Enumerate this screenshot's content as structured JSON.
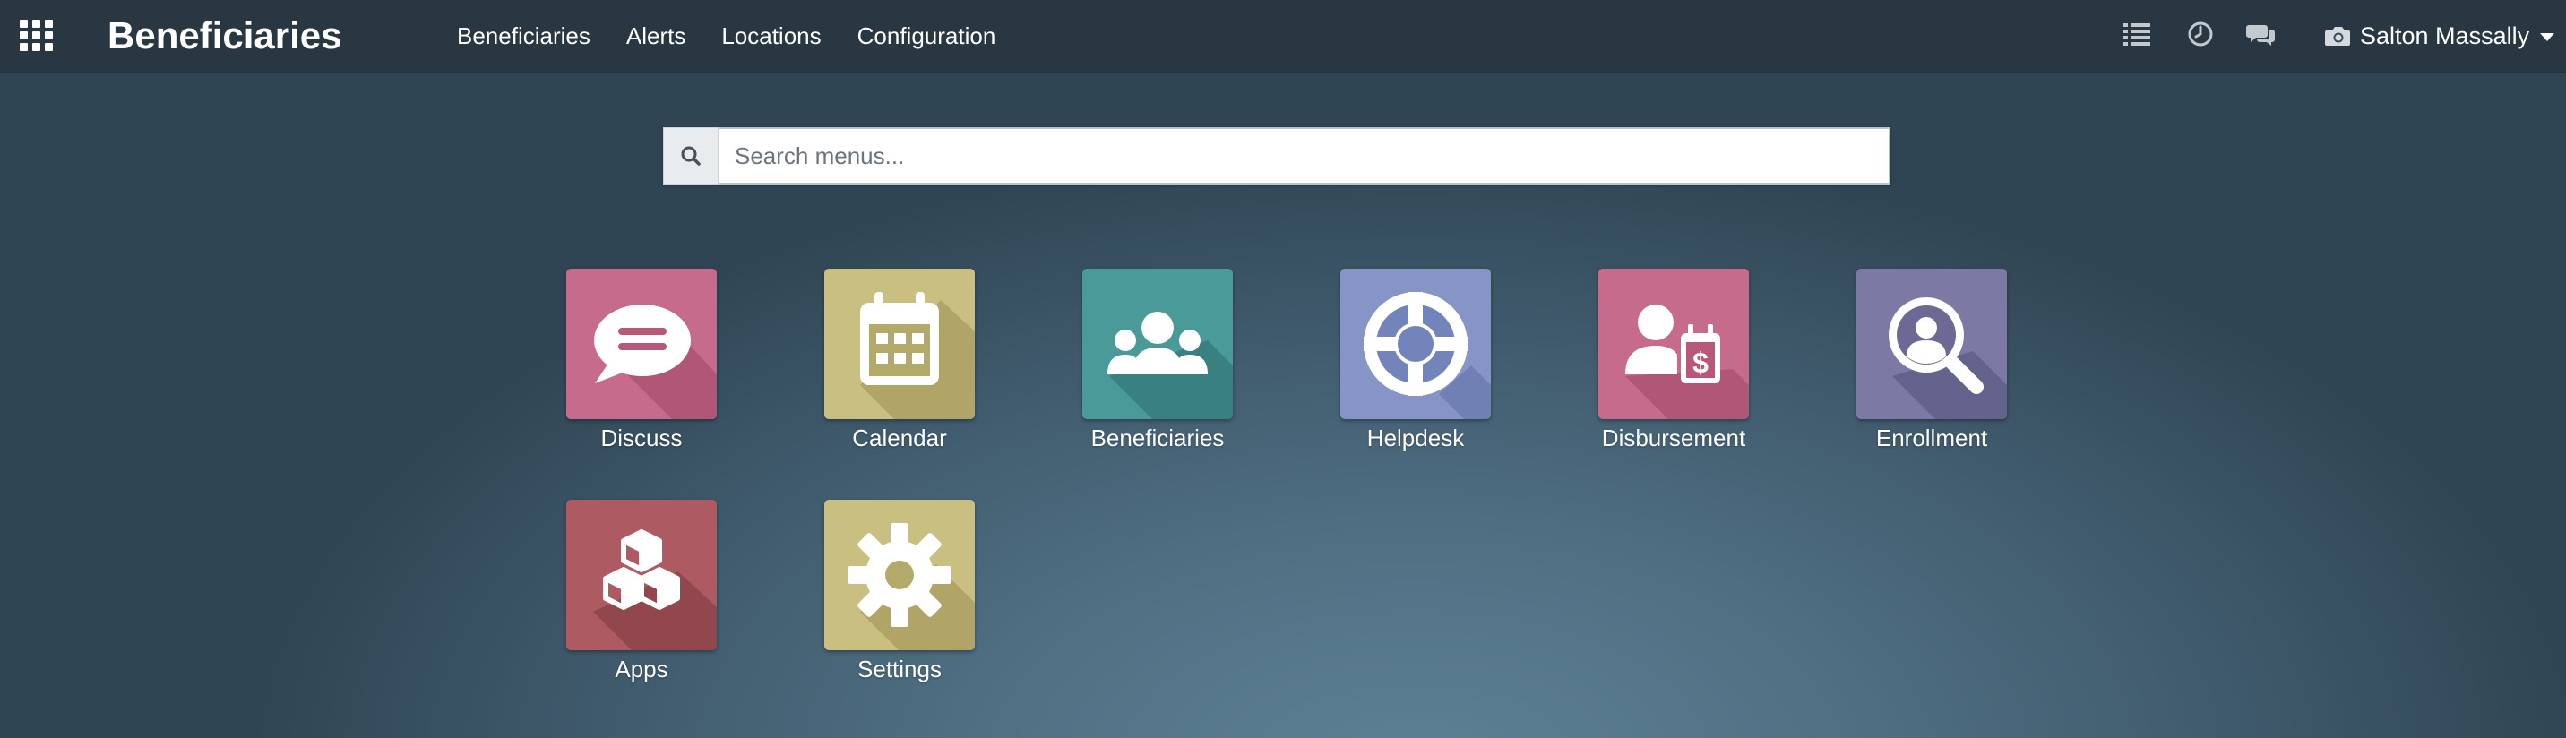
{
  "navbar": {
    "apps_icon": "grid-icon",
    "brand": "Beneficiaries",
    "menu": [
      {
        "label": "Beneficiaries"
      },
      {
        "label": "Alerts"
      },
      {
        "label": "Locations"
      },
      {
        "label": "Configuration"
      }
    ],
    "systray": {
      "icons": [
        "activity-list-icon",
        "clock-icon",
        "chat-icon"
      ]
    },
    "user": {
      "icon": "camera-icon",
      "name": "Salton Massally"
    }
  },
  "search": {
    "placeholder": "Search menus...",
    "value": "",
    "icon": "search-icon"
  },
  "apps": [
    {
      "label": "Discuss",
      "icon": "discuss-icon",
      "color": "#b8577a",
      "color_light": "#c96d8e"
    },
    {
      "label": "Calendar",
      "icon": "calendar-icon",
      "color": "#b3aa6a",
      "color_light": "#c9bf80"
    },
    {
      "label": "Beneficiaries",
      "icon": "beneficiaries-icon",
      "color": "#3f8a8b",
      "color_light": "#4a9a9a"
    },
    {
      "label": "Helpdesk",
      "icon": "helpdesk-icon",
      "color": "#7384ba",
      "color_light": "#8694c6"
    },
    {
      "label": "Disbursement",
      "icon": "disbursement-icon",
      "color": "#b8577a",
      "color_light": "#c96d8e"
    },
    {
      "label": "Enrollment",
      "icon": "enrollment-icon",
      "color": "#6c6a94",
      "color_light": "#7c7aa4"
    },
    {
      "label": "Apps",
      "icon": "apps-cubes-icon",
      "color": "#9e4a52",
      "color_light": "#ad5a62"
    },
    {
      "label": "Settings",
      "icon": "gear-icon",
      "color": "#b3aa6a",
      "color_light": "#c9bf80"
    }
  ]
}
